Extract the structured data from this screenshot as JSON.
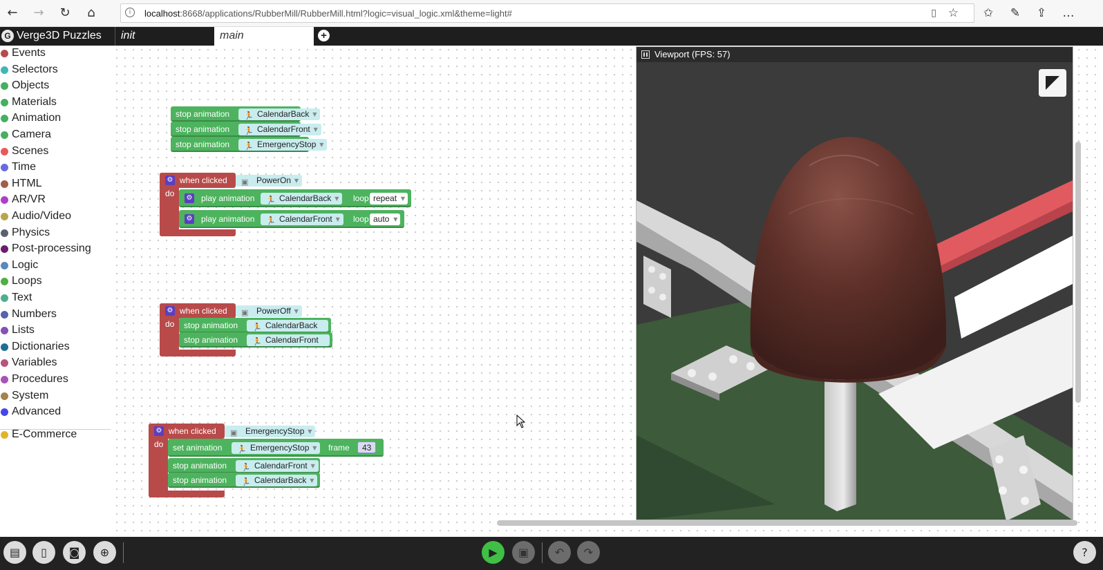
{
  "browser": {
    "url_host": "localhost",
    "url_rest": ":8668/applications/RubberMill/RubberMill.html?logic=visual_logic.xml&theme=light#"
  },
  "app": {
    "title": "Verge3D Puzzles"
  },
  "tabs": [
    {
      "label": "init"
    },
    {
      "label": "main"
    }
  ],
  "categories": [
    {
      "label": "Events",
      "color": "#b84a4a"
    },
    {
      "label": "Selectors",
      "color": "#3fb7b7"
    },
    {
      "label": "Objects",
      "color": "#44b062"
    },
    {
      "label": "Materials",
      "color": "#44b062"
    },
    {
      "label": "Animation",
      "color": "#44b062"
    },
    {
      "label": "Camera",
      "color": "#44b062"
    },
    {
      "label": "Scenes",
      "color": "#e85a5a"
    },
    {
      "label": "Time",
      "color": "#6a6ae0"
    },
    {
      "label": "HTML",
      "color": "#a35d49"
    },
    {
      "label": "AR/VR",
      "color": "#b03ec9"
    },
    {
      "label": "Audio/Video",
      "color": "#b8a64d"
    },
    {
      "label": "Physics",
      "color": "#5a6270"
    },
    {
      "label": "Post-processing",
      "color": "#6b1d6b"
    },
    {
      "label": "Logic",
      "color": "#5a88bf"
    },
    {
      "label": "Loops",
      "color": "#4fae45"
    },
    {
      "label": "Text",
      "color": "#4fae8e"
    },
    {
      "label": "Numbers",
      "color": "#5a60b0"
    },
    {
      "label": "Lists",
      "color": "#8353b8"
    },
    {
      "label": "Dictionaries",
      "color": "#1c6f96"
    },
    {
      "label": "Variables",
      "color": "#b8547c"
    },
    {
      "label": "Procedures",
      "color": "#a654b8"
    },
    {
      "label": "System",
      "color": "#a6824d"
    },
    {
      "label": "Advanced",
      "color": "#4646e8"
    },
    {
      "label": "E-Commerce",
      "color": "#e0b52a"
    }
  ],
  "blocks": {
    "group1": [
      {
        "action": "stop animation",
        "target": "CalendarBack"
      },
      {
        "action": "stop animation",
        "target": "CalendarFront"
      },
      {
        "action": "stop animation",
        "target": "EmergencyStop"
      }
    ],
    "group2": {
      "event": "when clicked",
      "object": "PowerOn",
      "do": "do",
      "rows": [
        {
          "action": "play animation",
          "target": "CalendarBack",
          "loop_label": "loop",
          "loop": "repeat"
        },
        {
          "action": "play animation",
          "target": "CalendarFront",
          "loop_label": "loop",
          "loop": "auto"
        }
      ]
    },
    "group3": {
      "event": "when clicked",
      "object": "PowerOff",
      "do": "do",
      "rows": [
        {
          "action": "stop animation",
          "target": "CalendarBack"
        },
        {
          "action": "stop animation",
          "target": "CalendarFront"
        }
      ]
    },
    "group4": {
      "event": "when clicked",
      "object": "EmergencyStop",
      "do": "do",
      "set": {
        "action": "set animation",
        "target": "EmergencyStop",
        "frame_label": "frame",
        "frame": "43"
      },
      "rows": [
        {
          "action": "stop animation",
          "target": "CalendarFront"
        },
        {
          "action": "stop animation",
          "target": "CalendarBack"
        }
      ]
    }
  },
  "viewport": {
    "title": "Viewport (FPS: 57)"
  }
}
